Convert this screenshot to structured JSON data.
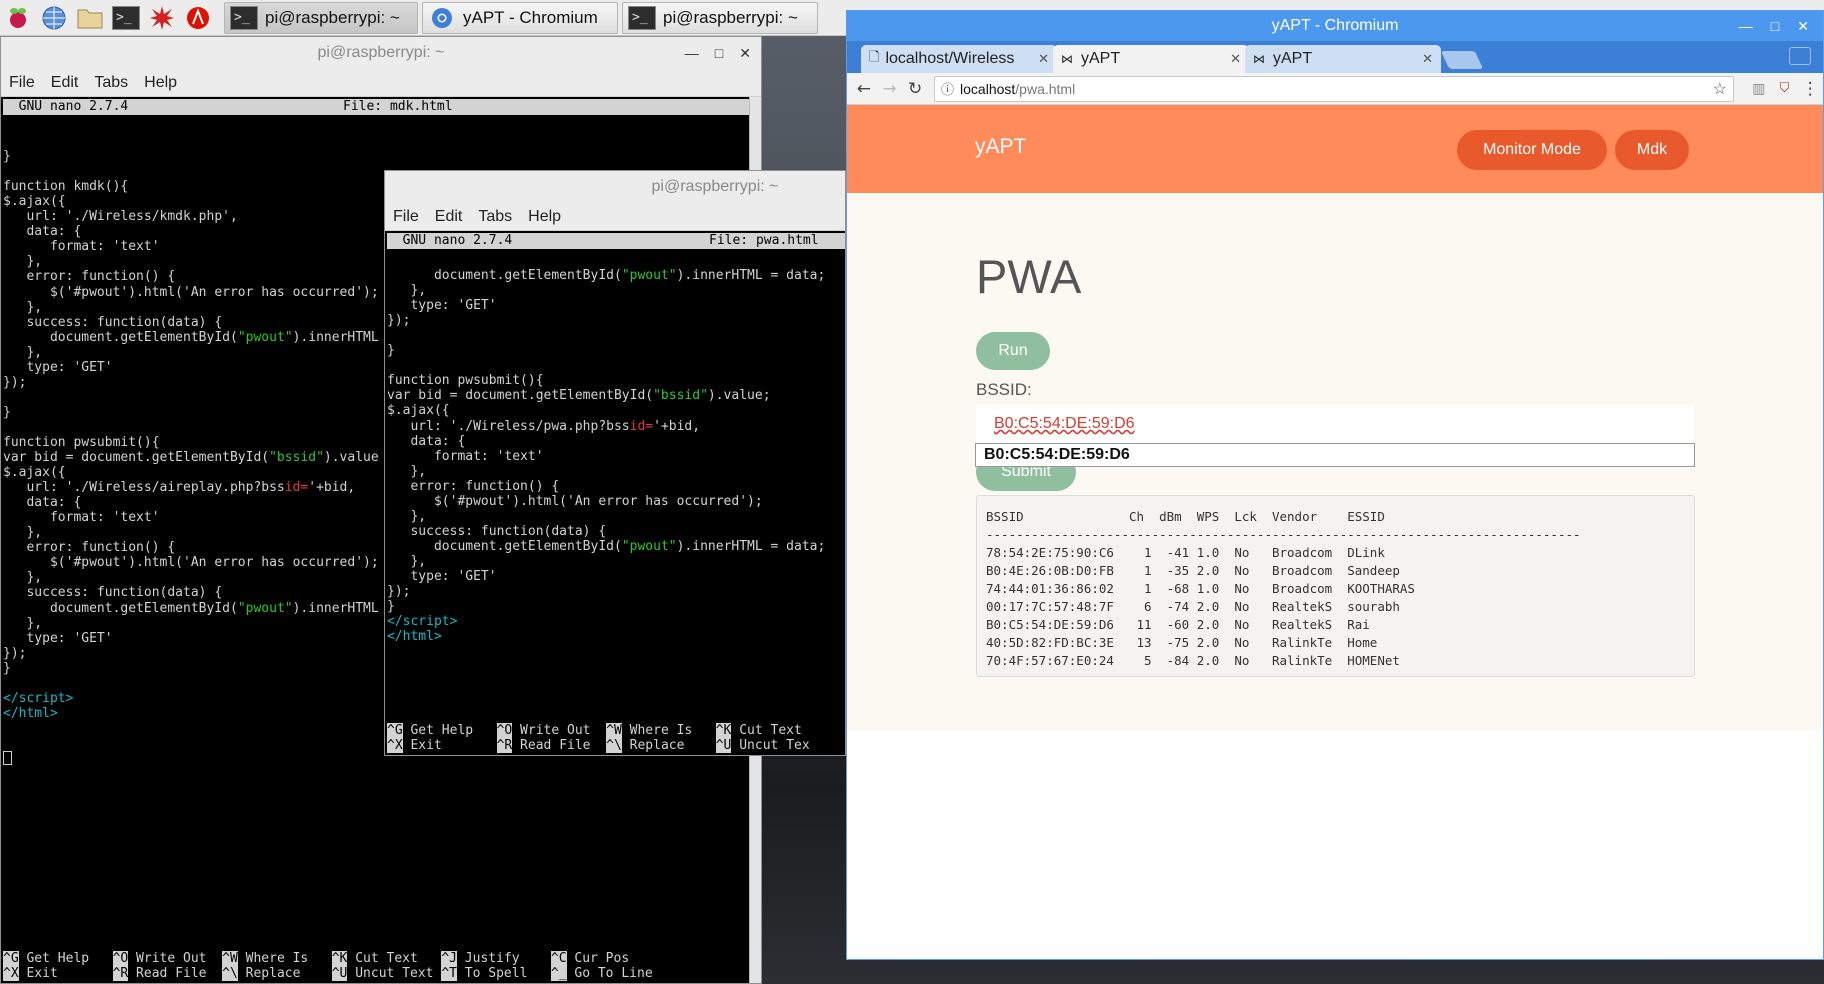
{
  "taskbar": {
    "launchers": [
      "raspberry-icon",
      "globe-icon",
      "folder-icon",
      "terminal-icon",
      "burst-icon",
      "wolfram-icon"
    ],
    "windows": [
      {
        "label": "pi@raspberrypi: ~",
        "icon": "terminal-icon"
      },
      {
        "label": "yAPT - Chromium",
        "icon": "chromium-icon"
      },
      {
        "label": "pi@raspberrypi: ~",
        "icon": "terminal-icon"
      }
    ]
  },
  "term1": {
    "title": "pi@raspberrypi: ~",
    "menu": [
      "File",
      "Edit",
      "Tabs",
      "Help"
    ],
    "nano_version": "  GNU nano 2.7.4",
    "nano_file": "File: mdk.html",
    "footer_row1": [
      [
        "^G",
        " Get Help"
      ],
      [
        "^O",
        " Write Out"
      ],
      [
        "^W",
        " Where Is"
      ],
      [
        "^K",
        " Cut Text"
      ],
      [
        "^J",
        " Justify"
      ],
      [
        "^C",
        " Cur Pos"
      ]
    ],
    "footer_row2": [
      [
        "^X",
        " Exit"
      ],
      [
        "^R",
        " Read File"
      ],
      [
        "^\\",
        " Replace"
      ],
      [
        "^U",
        " Uncut Text"
      ],
      [
        "^T",
        " To Spell"
      ],
      [
        "^_",
        " Go To Line"
      ]
    ]
  },
  "term2": {
    "title": "pi@raspberrypi: ~",
    "menu": [
      "File",
      "Edit",
      "Tabs",
      "Help"
    ],
    "nano_version": "  GNU nano 2.7.4",
    "nano_file": "File: pwa.html",
    "footer_row1": [
      [
        "^G",
        " Get Help"
      ],
      [
        "^O",
        " Write Out"
      ],
      [
        "^W",
        " Where Is"
      ],
      [
        "^K",
        " Cut Text"
      ]
    ],
    "footer_row2": [
      [
        "^X",
        " Exit"
      ],
      [
        "^R",
        " Read File"
      ],
      [
        "^\\",
        " Replace"
      ],
      [
        "^U",
        " Uncut Tex"
      ]
    ]
  },
  "chromium": {
    "window_title": "yAPT - Chromium",
    "tabs": [
      {
        "label": "localhost/Wireless",
        "icon": "page-icon"
      },
      {
        "label": "yAPT",
        "icon": "bowtie-icon"
      },
      {
        "label": "yAPT",
        "icon": "bowtie-icon"
      }
    ],
    "url_host": "localhost",
    "url_path": "/pwa.html",
    "site": {
      "brand": "yAPT",
      "nav": [
        "Monitor Mode",
        "Mdk"
      ],
      "page_title": "PWA",
      "run_label": "Run",
      "bssid_label": "BSSID:",
      "bssid_value": "B0:C5:54:DE:59:D6",
      "autocomplete_value": "B0:C5:54:DE:59:D6",
      "submit_label": "Submit",
      "table": {
        "headers": [
          "BSSID",
          "Ch",
          "dBm",
          "WPS",
          "Lck",
          "Vendor",
          "ESSID"
        ],
        "rows": [
          [
            "78:54:2E:75:90:C6",
            "1",
            "-41",
            "1.0",
            "No",
            "Broadcom",
            "DLink"
          ],
          [
            "B0:4E:26:0B:D0:FB",
            "1",
            "-35",
            "2.0",
            "No",
            "Broadcom",
            "Sandeep"
          ],
          [
            "74:44:01:36:86:02",
            "1",
            "-68",
            "1.0",
            "No",
            "Broadcom",
            "KOOTHARAS"
          ],
          [
            "00:17:7C:57:48:7F",
            "6",
            "-74",
            "2.0",
            "No",
            "RealtekS",
            "sourabh"
          ],
          [
            "B0:C5:54:DE:59:D6",
            "11",
            "-60",
            "2.0",
            "No",
            "RealtekS",
            "Rai"
          ],
          [
            "40:5D:82:FD:BC:3E",
            "13",
            "-75",
            "2.0",
            "No",
            "RalinkTe",
            "Home"
          ],
          [
            "70:4F:57:67:E0:24",
            "5",
            "-84",
            "2.0",
            "No",
            "RalinkTe",
            "HOMENet"
          ]
        ]
      }
    }
  },
  "colors": {
    "header_orange": "#ff8a5a",
    "pill_orange": "#e8592b",
    "green_button": "#8fbf9e",
    "chrome_blue": "#4d98ef"
  }
}
